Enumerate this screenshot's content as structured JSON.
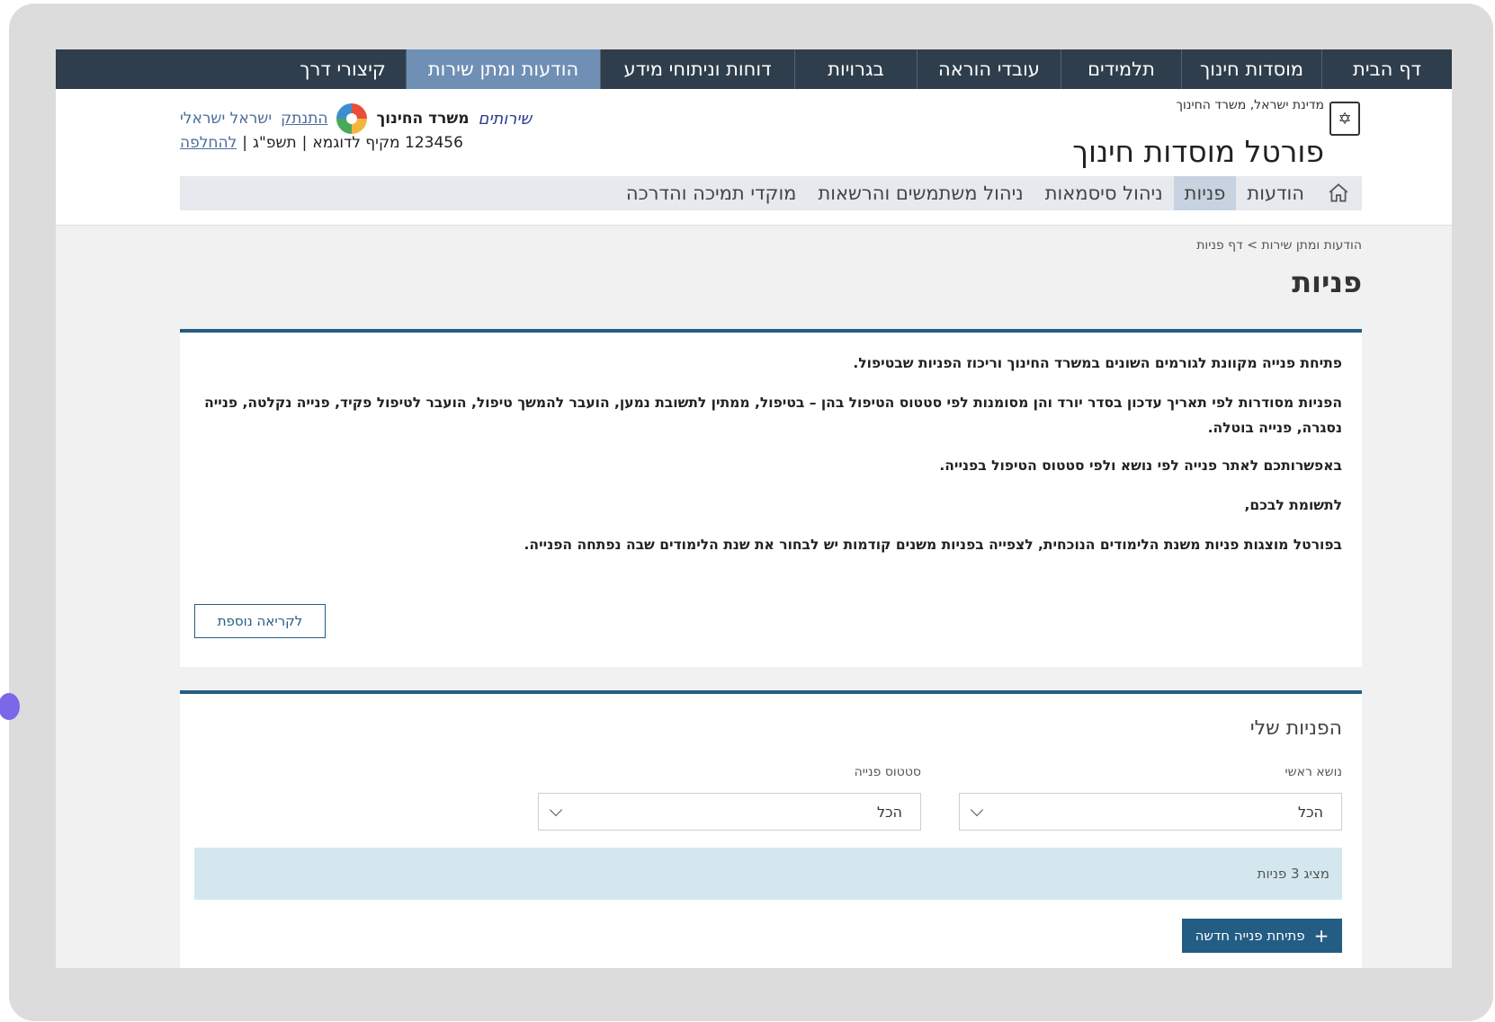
{
  "topnav": {
    "items": [
      "דף הבית",
      "מוסדות חינוך",
      "תלמידים",
      "עובדי הוראה",
      "בגרויות",
      "דוחות וניתוחי מידע",
      "הודעות ומתן שירות",
      "קיצורי דרך"
    ]
  },
  "header": {
    "state_line": "מדינת ישראל, משרד החינוך",
    "portal_title": "פורטל מוסדות חינוך",
    "user_name": "ישראל ישראלי",
    "logout_link": "התנתק",
    "ministry_name": "משרד החינוך",
    "service_brand": "שירותים",
    "institution": "123456 מקיף לדוגמא",
    "year": "תשפ\"ג",
    "switch_link": "להחלפה"
  },
  "subnav": {
    "items": [
      "הודעות",
      "פניות",
      "ניהול סיסמאות",
      "ניהול משתמשים והרשאות",
      "מוקדי תמיכה והדרכה"
    ],
    "active_index": 1
  },
  "breadcrumb": "הודעות ומתן שירות > דף פניות",
  "page_title": "פניות",
  "intro": {
    "p1": "פתיחת פנייה מקוונת לגורמים השונים במשרד החינוך וריכוז הפניות שבטיפול.",
    "p2": "הפניות מסודרות לפי תאריך עדכון בסדר יורד והן מסומנות לפי סטטוס הטיפול בהן – בטיפול, ממתין לתשובת נמען, הועבר להמשך טיפול, הועבר לטיפול פקיד, פנייה נקלטה, פנייה נסגרה, פנייה בוטלה.",
    "p3": "באפשרותכם לאתר פנייה לפי נושא ולפי סטטוס הטיפול בפנייה.",
    "p4": "לתשומת לבכם,",
    "p5": "בפורטל מוצגות פניות משנת הלימודים הנוכחית, לצפייה בפניות משנים קודמות יש לבחור את שנת הלימודים שבה נפתחה הפנייה.",
    "more_button": "לקריאה נוספת"
  },
  "my_requests": {
    "title": "הפניות שלי",
    "topic_label": "נושא ראשי",
    "topic_value": "הכל",
    "status_label": "סטטוס פנייה",
    "status_value": "הכל",
    "count_text": "מציג 3 פניות",
    "new_button": "פתיחת פנייה חדשה"
  },
  "colors": {
    "topnav_bg": "#2f3e4d",
    "topnav_active": "#6f8fb5",
    "accent": "#245d84",
    "count_bar": "#d3e8ee"
  },
  "icons": [
    "home-icon",
    "emblem-icon",
    "ministry-logo-icon",
    "chevron-down-icon",
    "plus-icon"
  ]
}
